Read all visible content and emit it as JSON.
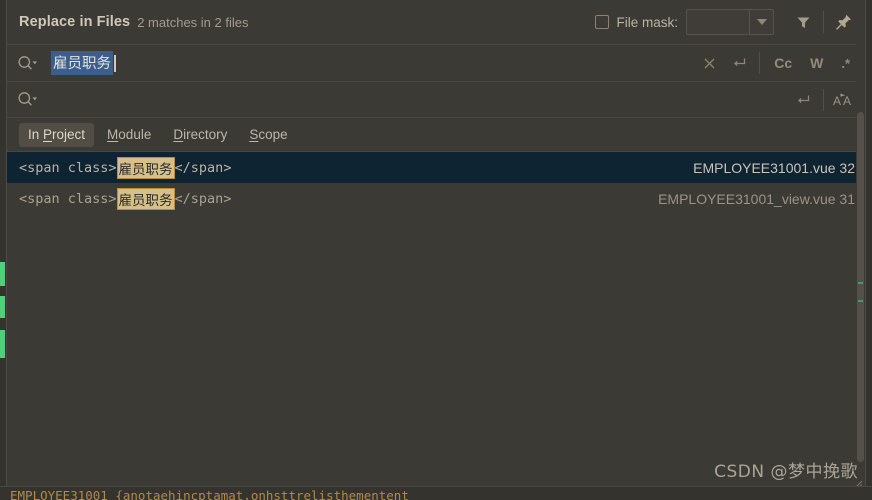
{
  "header": {
    "title": "Replace in Files",
    "summary": "2 matches in 2 files",
    "file_mask_label": "File mask:",
    "file_mask_value": "",
    "filter_icon": "filter-funnel-icon",
    "pin_icon": "pin-icon"
  },
  "search_field": {
    "icon": "search-dropdown-icon",
    "value": "雇员职务",
    "clear_label": "✕",
    "newline_label": "⏎",
    "match_case_label": "Cc",
    "words_label": "W",
    "regex_label": ".*"
  },
  "replace_field": {
    "icon": "search-dropdown-icon",
    "value": "",
    "newline_label": "⏎",
    "preserve_case_label": "A͟A"
  },
  "scope_tabs": [
    {
      "label": "In Project",
      "pre": "In ",
      "mnemonic": "P",
      "post": "roject",
      "active": true
    },
    {
      "label": "Module",
      "pre": "",
      "mnemonic": "M",
      "post": "odule",
      "active": false
    },
    {
      "label": "Directory",
      "pre": "",
      "mnemonic": "D",
      "post": "irectory",
      "active": false
    },
    {
      "label": "Scope",
      "pre": "",
      "mnemonic": "S",
      "post": "cope",
      "active": false
    }
  ],
  "results": [
    {
      "prefix": "<span class>",
      "match": "雇员职务",
      "suffix": "</span>",
      "file": "EMPLOYEE31001.vue",
      "line": "32",
      "selected": true
    },
    {
      "prefix": "<span class>",
      "match": "雇员职务",
      "suffix": "</span>",
      "file": "EMPLOYEE31001_view.vue",
      "line": "31",
      "selected": false
    }
  ],
  "background_code": {
    "line": "EMPLOYEE31001          {anotaehincptamat,onhsttrelisthementent"
  },
  "watermark": "CSDN @梦中挽歌",
  "colors": {
    "panel_bg": "#3c3a35",
    "selected_row": "#0e2433",
    "match_highlight": "#d6c08a",
    "match_border": "#c08b35",
    "text_selection": "#3b5e8c",
    "gutter_green": "#4fd07a"
  }
}
